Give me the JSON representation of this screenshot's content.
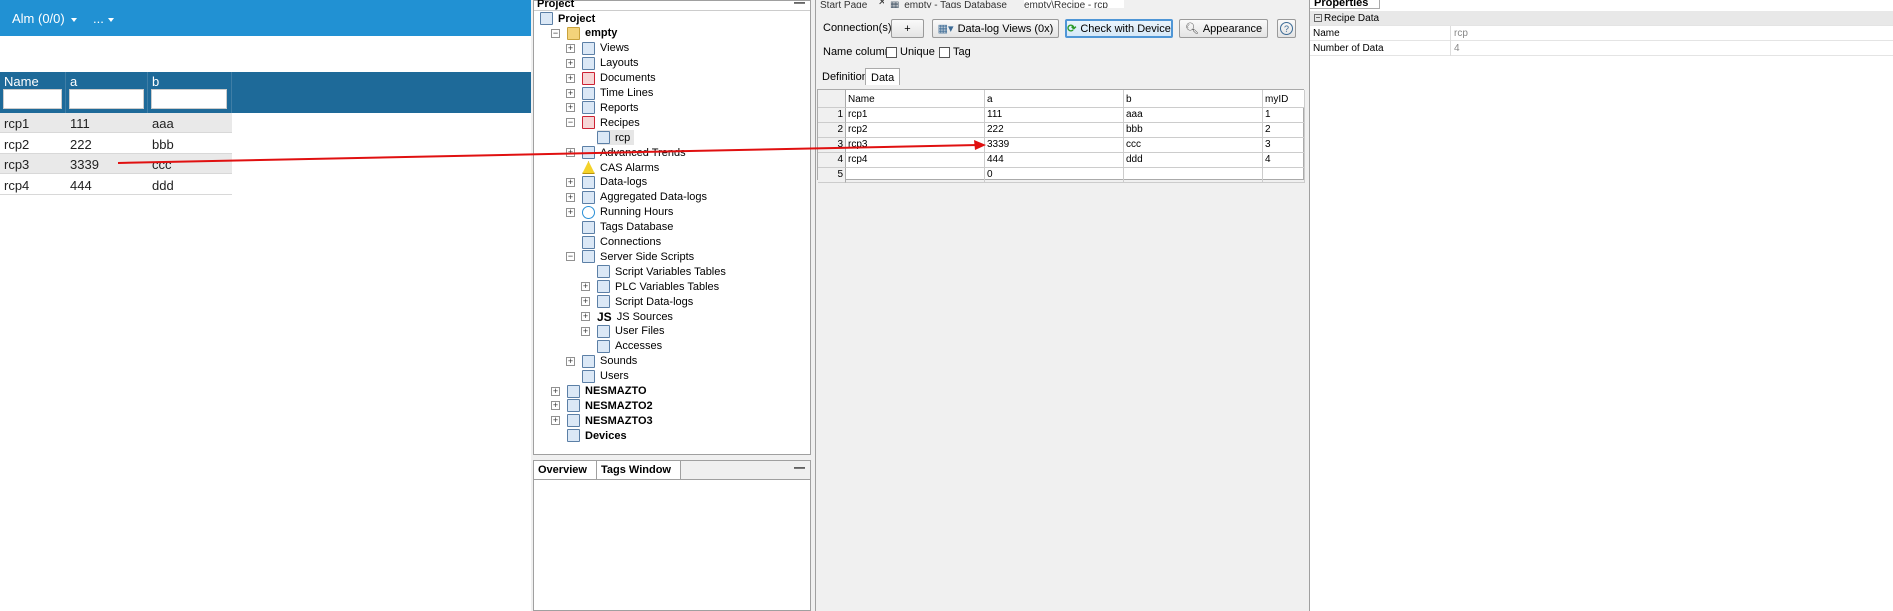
{
  "runtime": {
    "alm_label": "Alm (0/0)",
    "more_label": "...",
    "columns": [
      "Name",
      "a",
      "b"
    ],
    "rows": [
      [
        "rcp1",
        "111",
        "aaa"
      ],
      [
        "rcp2",
        "222",
        "bbb"
      ],
      [
        "rcp3",
        "3339",
        "ccc"
      ],
      [
        "rcp4",
        "444",
        "ddd"
      ]
    ]
  },
  "project": {
    "title": "Project",
    "minimize": "—",
    "tree": [
      {
        "label": "Project",
        "bold": true
      },
      {
        "label": "empty",
        "bold": true
      },
      {
        "label": "Views"
      },
      {
        "label": "Layouts"
      },
      {
        "label": "Documents"
      },
      {
        "label": "Time Lines"
      },
      {
        "label": "Reports"
      },
      {
        "label": "Recipes"
      },
      {
        "label": "rcp"
      },
      {
        "label": "Advanced Trends"
      },
      {
        "label": "CAS Alarms"
      },
      {
        "label": "Data-logs"
      },
      {
        "label": "Aggregated Data-logs"
      },
      {
        "label": "Running Hours"
      },
      {
        "label": "Tags Database"
      },
      {
        "label": "Connections"
      },
      {
        "label": "Server Side Scripts"
      },
      {
        "label": "Script Variables Tables"
      },
      {
        "label": "PLC Variables Tables"
      },
      {
        "label": "Script Data-logs"
      },
      {
        "label": "JS Sources"
      },
      {
        "label": "User Files"
      },
      {
        "label": "Accesses"
      },
      {
        "label": "Sounds"
      },
      {
        "label": "Users"
      },
      {
        "label": "NESMAZTO",
        "bold": true
      },
      {
        "label": "NESMAZTO2",
        "bold": true
      },
      {
        "label": "NESMAZTO3",
        "bold": true
      },
      {
        "label": "Devices",
        "bold": true
      }
    ]
  },
  "bottom": {
    "tabs": [
      "Overview",
      "Tags Window"
    ],
    "minimize": "—"
  },
  "editor": {
    "doc_tabs": [
      "Start Page",
      "empty - Tags Database",
      "empty\\Recipe - rcp"
    ],
    "connections_label": "Connection(s):",
    "add_label": "+",
    "datalog_label": "Data-log Views (0x)",
    "check_label": "Check with Device",
    "appearance_label": "Appearance",
    "help_label": "?",
    "name_column_label": "Name column:",
    "unique_label": "Unique",
    "tag_label": "Tag",
    "sub_tabs": [
      "Definition",
      "Data"
    ],
    "table": {
      "headers": [
        "",
        "Name",
        "a",
        "b",
        "myID"
      ],
      "rows": [
        [
          "1",
          "rcp1",
          "111",
          "aaa",
          "1"
        ],
        [
          "2",
          "rcp2",
          "222",
          "bbb",
          "2"
        ],
        [
          "3",
          "rcp3",
          "3339",
          "ccc",
          "3"
        ],
        [
          "4",
          "rcp4",
          "444",
          "ddd",
          "4"
        ],
        [
          "5",
          "",
          "0",
          "",
          ""
        ]
      ]
    }
  },
  "properties": {
    "title": "Properties",
    "section": "Recipe Data",
    "rows": [
      {
        "name": "Name",
        "value": "rcp"
      },
      {
        "name": "Number of Data",
        "value": "4"
      }
    ]
  },
  "colors": {
    "runtime_bar": "#2191d3",
    "grid_header": "#1e6a99",
    "annotation_arrow": "#e01010"
  }
}
